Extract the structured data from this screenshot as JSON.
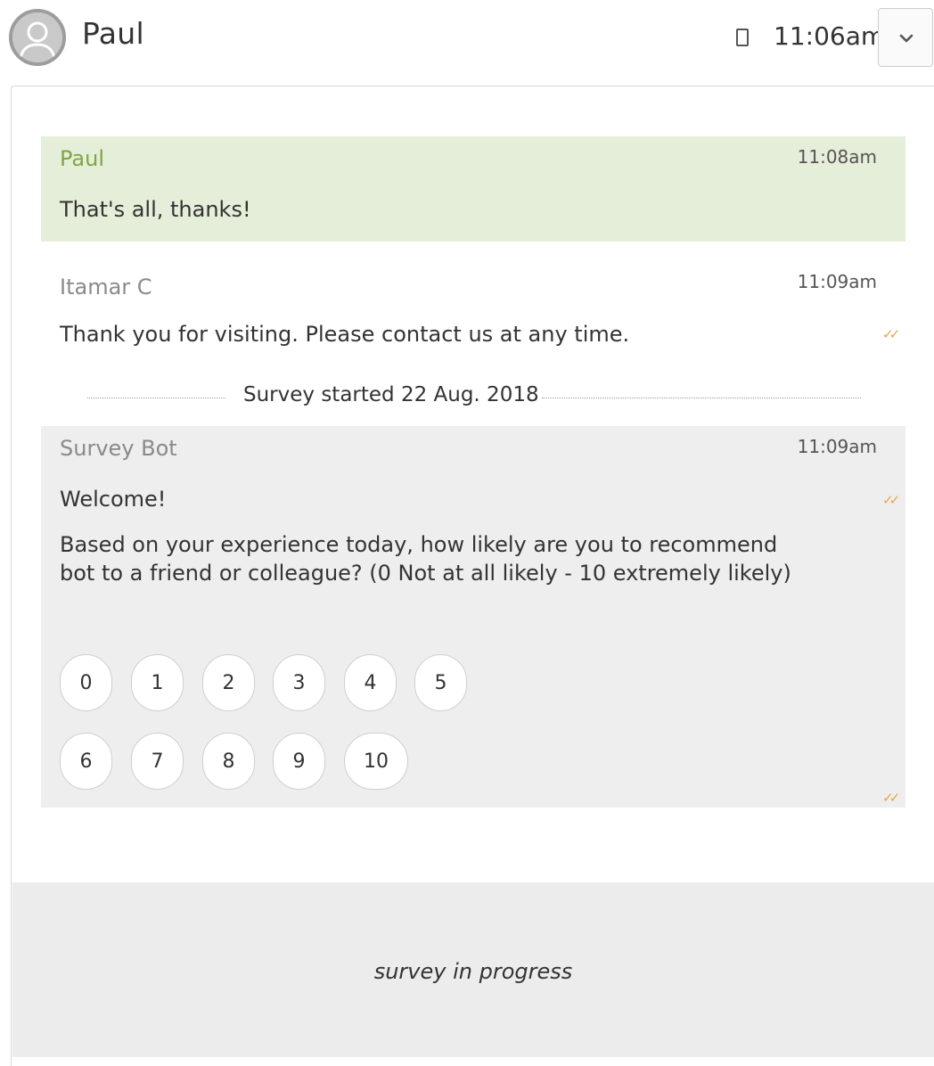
{
  "header": {
    "contact_name": "Paul",
    "time": "11:06am",
    "device_icon": "mobile-phone-icon",
    "dropdown_icon": "chevron-down-icon"
  },
  "messages": [
    {
      "sender": "Paul",
      "time": "11:08am",
      "text": "That's all, thanks!"
    },
    {
      "sender": "Itamar C",
      "time": "11:09am",
      "text": "Thank you for visiting. Please contact us at any time.",
      "status_icon": "double-check-icon"
    }
  ],
  "divider": {
    "label": "Survey started 22 Aug. 2018"
  },
  "survey": {
    "sender": "Survey Bot",
    "time": "11:09am",
    "welcome": "Welcome!",
    "question": "Based on your experience today, how likely are you to recommend bot to a friend or colleague? (0 Not at all likely - 10 extremely likely)",
    "options_row1": [
      "0",
      "1",
      "2",
      "3",
      "4",
      "5"
    ],
    "options_row2": [
      "6",
      "7",
      "8",
      "9",
      "10"
    ]
  },
  "footer": {
    "status": "survey in progress"
  },
  "colors": {
    "customer_bubble": "#e5eed9",
    "customer_name": "#7ea546",
    "bot_bubble": "#eeeeee",
    "read_check": "#e8a44b"
  }
}
